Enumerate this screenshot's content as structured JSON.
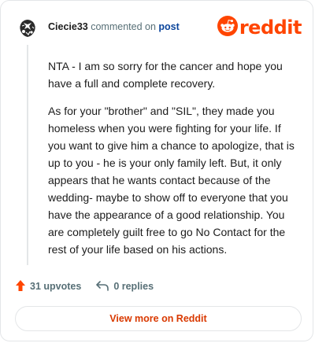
{
  "header": {
    "username": "Ciecie33",
    "action_text": "commented on",
    "target_text": "post",
    "logo_text": "reddit"
  },
  "comment": {
    "paragraphs": [
      "NTA - I am so sorry for the cancer and hope you have a full and complete recovery.",
      "As for your \"brother\" and \"SIL\", they made you homeless when you were fighting for your life. If you want to give him a chance to apologize, that is up to you - he is your only family left. But, it only appears that he wants contact because of the wedding- maybe to show off to everyone that you have the appearance of a good relationship. You are completely guilt free to go No Contact for the rest of your life based on his actions."
    ]
  },
  "actions": {
    "upvotes_label": "31 upvotes",
    "replies_label": "0 replies"
  },
  "footer": {
    "view_more_label": "View more on Reddit"
  },
  "icons": {
    "avatar": "avatar-icon",
    "logo": "reddit-snoo-icon",
    "upvote": "upvote-arrow-icon",
    "reply": "reply-arrow-icon"
  },
  "colors": {
    "brand": "#ff4500",
    "link": "#0a449b",
    "muted": "#576f76",
    "text": "#1c1c1c",
    "border": "#e4e6e8",
    "view_more": "#d93900"
  }
}
